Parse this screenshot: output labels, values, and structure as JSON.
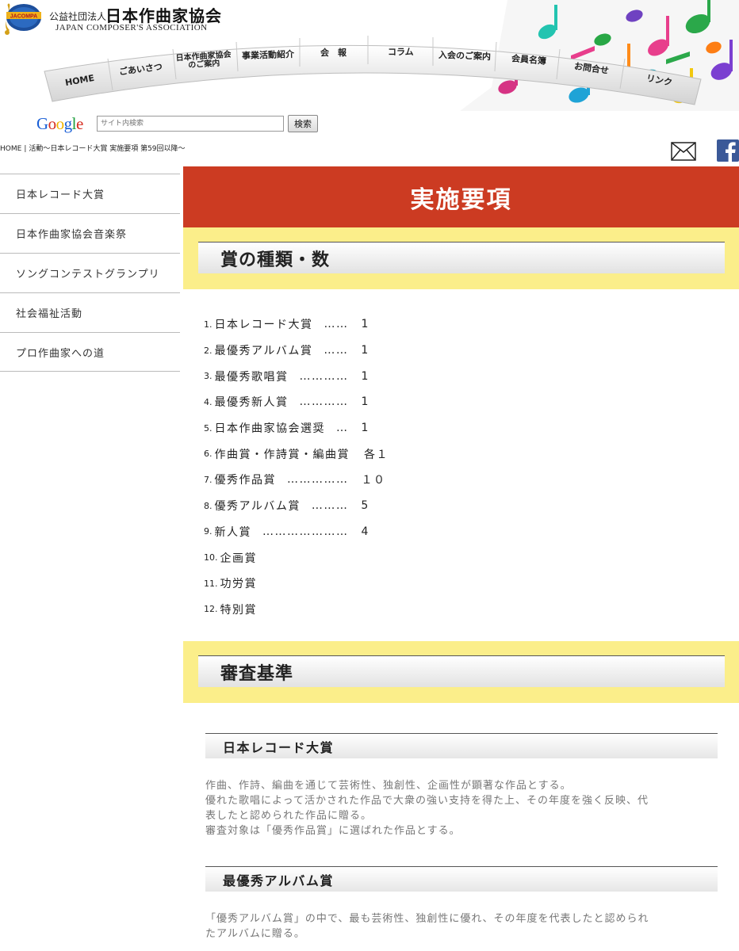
{
  "header": {
    "logo_text": "JACOMPA",
    "org_prefix": "公益社団法人",
    "org_name": "日本作曲家協会",
    "org_name_en": "JAPAN COMPOSER'S ASSOCIATION"
  },
  "nav": {
    "items": [
      {
        "label": "HOME"
      },
      {
        "label": "ごあいさつ"
      },
      {
        "label_line1": "日本作曲家協会",
        "label_line2": "のご案内"
      },
      {
        "label": "事業活動紹介"
      },
      {
        "label": "会　報"
      },
      {
        "label": "コラム"
      },
      {
        "label": "入会のご案内"
      },
      {
        "label": "会員名簿"
      },
      {
        "label": "お問合せ"
      },
      {
        "label": "リンク"
      }
    ]
  },
  "search": {
    "brand": "Google",
    "placeholder": "サイト内検索",
    "button_label": "検索"
  },
  "breadcrumb": {
    "home": "HOME",
    "separator": "|",
    "current": "活動～日本レコード大賞 実施要項 第59回以降～"
  },
  "social": {
    "mail_icon": "mail-icon",
    "facebook_icon": "facebook-icon",
    "facebook_color": "#3b5998"
  },
  "sidebar": {
    "items": [
      {
        "label": "日本レコード大賞"
      },
      {
        "label": "日本作曲家協会音楽祭"
      },
      {
        "label": "ソングコンテストグランプリ"
      },
      {
        "label": "社会福祉活動"
      },
      {
        "label": "プロ作曲家への道"
      }
    ]
  },
  "main": {
    "title": "実施要項",
    "title_bg": "#cc3b22",
    "band_color": "#fbee8a",
    "section1_title": "賞の種類・数",
    "awards": [
      {
        "num": "1.",
        "name": "日本レコード大賞",
        "dots": "……",
        "count": "1"
      },
      {
        "num": "2.",
        "name": "最優秀アルバム賞",
        "dots": "……",
        "count": "1"
      },
      {
        "num": "3.",
        "name": "最優秀歌唱賞",
        "dots": "…………",
        "count": "1"
      },
      {
        "num": "4.",
        "name": "最優秀新人賞",
        "dots": "…………",
        "count": "1"
      },
      {
        "num": "5.",
        "name": "日本作曲家協会選奨",
        "dots": "…",
        "count": "1"
      },
      {
        "num": "6.",
        "name": "作曲賞・作詩賞・編曲賞",
        "dots": "",
        "count": "各１"
      },
      {
        "num": "7.",
        "name": "優秀作品賞",
        "dots": "……………",
        "count": "１０"
      },
      {
        "num": "8.",
        "name": "優秀アルバム賞",
        "dots": "………",
        "count": "5"
      },
      {
        "num": "9.",
        "name": "新人賞",
        "dots": "…………………",
        "count": "4"
      },
      {
        "num": "10.",
        "name": "企画賞",
        "dots": "",
        "count": ""
      },
      {
        "num": "11.",
        "name": "功労賞",
        "dots": "",
        "count": ""
      },
      {
        "num": "12.",
        "name": "特別賞",
        "dots": "",
        "count": ""
      }
    ],
    "section2_title": "審査基準",
    "criteria": [
      {
        "title": "日本レコード大賞",
        "lines": [
          "作曲、作詩、編曲を通じて芸術性、独創性、企画性が顕著な作品とする。",
          "優れた歌唱によって活かされた作品で大衆の強い支持を得た上、その年度を強く反映、代",
          "表したと認められた作品に贈る。",
          "審査対象は「優秀作品賞」に選ばれた作品とする。"
        ]
      },
      {
        "title": "最優秀アルバム賞",
        "lines": [
          "「優秀アルバム賞」の中で、最も芸術性、独創性に優れ、その年度を代表したと認められ",
          "たアルバムに贈る。"
        ]
      }
    ]
  }
}
